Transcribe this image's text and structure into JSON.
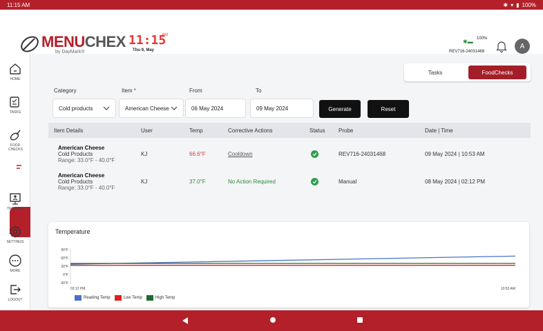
{
  "status_bar": {
    "time": "11:15 AM",
    "battery": "100%"
  },
  "header": {
    "brand_menu": "MENU",
    "brand_chex": "CHEX",
    "brand_sub": "by DayMark®",
    "clock_time": "11:15",
    "clock_ampm": "AM",
    "clock_date": "Thu 9, May",
    "device_battery": "100%",
    "device_id": "REV716-24031468",
    "avatar_initial": "A"
  },
  "sidebar": {
    "items": [
      {
        "label": "HOME",
        "icon": "home-icon"
      },
      {
        "label": "TASKS",
        "icon": "tasks-icon"
      },
      {
        "label": "FOOD CHECKS",
        "icon": "food-checks-icon"
      },
      {
        "label": "",
        "icon": "food-checks-report-icon"
      },
      {
        "label": "TRAINING",
        "icon": "training-icon"
      },
      {
        "label": "SETTINGS",
        "icon": "gear-icon"
      },
      {
        "label": "MORE",
        "icon": "more-icon"
      },
      {
        "label": "LOGOUT",
        "icon": "logout-icon"
      }
    ]
  },
  "toggle": {
    "tasks": "Tasks",
    "foodchecks": "FoodChecks"
  },
  "filters": {
    "category_label": "Category",
    "category_value": "Cold products",
    "item_label": "Item",
    "item_required": "*",
    "item_value": "American Cheese",
    "from_label": "From",
    "from_value": "06 May 2024",
    "to_label": "To",
    "to_value": "09 May 2024",
    "generate": "Generate",
    "reset": "Reset"
  },
  "table": {
    "headers": [
      "Item Details",
      "User",
      "Temp",
      "Corrective Actions",
      "Status",
      "Probe",
      "Date | Time"
    ],
    "rows": [
      {
        "name": "American Cheese",
        "category": "Cold Products",
        "range": "Range: 33.0°F - 40.0°F",
        "user": "KJ",
        "temp": "66.6°F",
        "action": "Cooldown",
        "probe": "REV716-24031468",
        "datetime": "09 May 2024 | 10:53 AM"
      },
      {
        "name": "American Cheese",
        "category": "Cold Products",
        "range": "Range: 33.0°F - 40.0°F",
        "user": "KJ",
        "temp": "37.0°F",
        "action": "No Action Required",
        "probe": "Manual",
        "datetime": "08 May 2024 | 02:12 PM"
      }
    ]
  },
  "chart_data": {
    "type": "line",
    "title": "Temperature",
    "x": [
      "02:12 PM",
      "10:53 AM"
    ],
    "ytick_labels": [
      "90°F",
      "60°F",
      "30°F",
      "0°F",
      "-30°F"
    ],
    "ylim": [
      -30,
      90
    ],
    "series": [
      {
        "name": "Reading Temp",
        "color": "#4a72c4",
        "values": [
          37.0,
          66.6
        ]
      },
      {
        "name": "Low Temp",
        "color": "#e02020",
        "values": [
          33.0,
          33.0
        ]
      },
      {
        "name": "High Temp",
        "color": "#1e6b2c",
        "values": [
          40.0,
          40.0
        ]
      }
    ],
    "legend": "bottom-left",
    "grid": false
  },
  "colors": {
    "brand": "#b3202a",
    "accent": "#a31e29",
    "ok": "#2e9e4d"
  }
}
